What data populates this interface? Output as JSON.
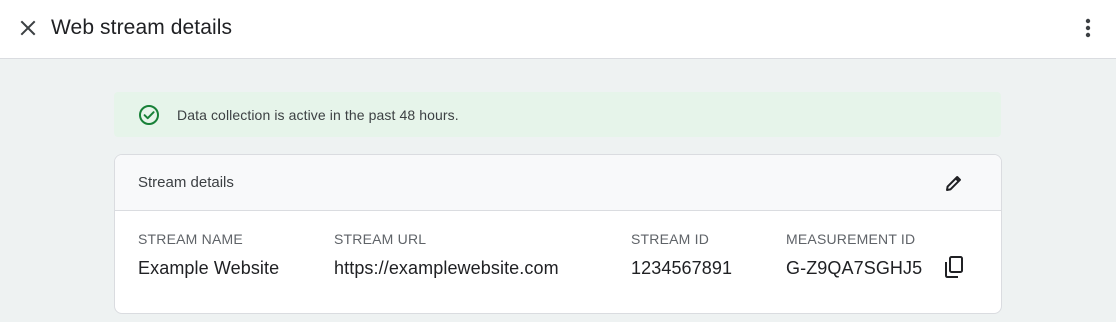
{
  "header": {
    "title": "Web stream details",
    "close_icon": "close-icon",
    "more_icon": "more-vert-icon"
  },
  "banner": {
    "text": "Data collection is active in the past 48 hours.",
    "icon": "check-circle-icon",
    "background": "#e6f4ea",
    "icon_color": "#188038"
  },
  "stream_details": {
    "title": "Stream details",
    "edit_icon": "pencil-icon",
    "fields": [
      {
        "label": "STREAM NAME",
        "value": "Example Website"
      },
      {
        "label": "STREAM URL",
        "value": "https://examplewebsite.com"
      },
      {
        "label": "STREAM ID",
        "value": "1234567891"
      },
      {
        "label": "MEASUREMENT ID",
        "value": "G-Z9QA7SGHJ5"
      }
    ],
    "copy_icon": "copy-icon"
  }
}
